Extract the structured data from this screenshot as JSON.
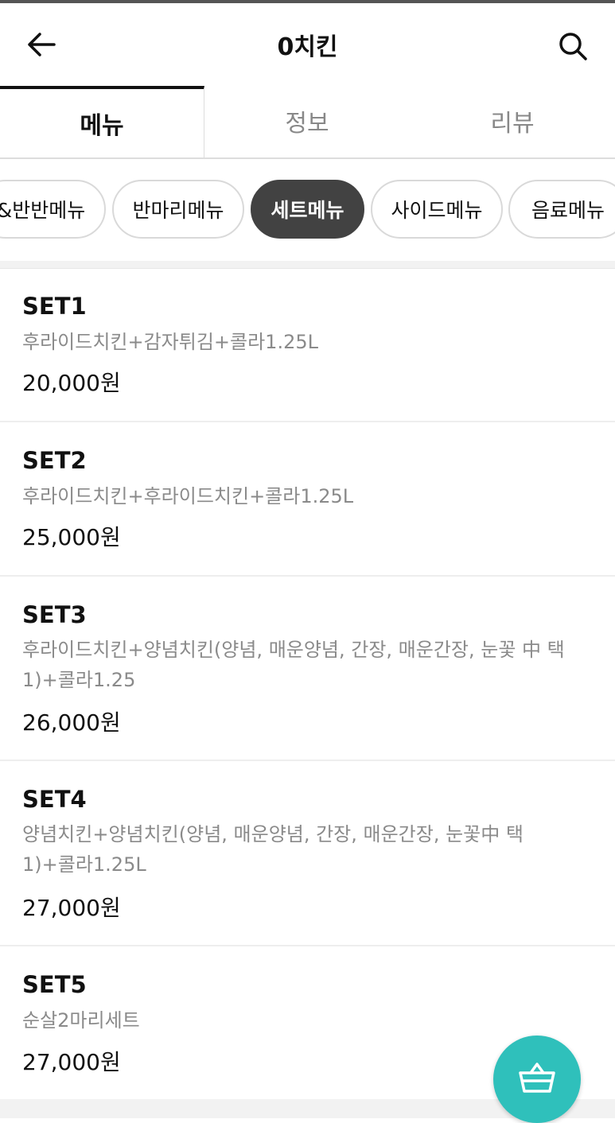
{
  "header": {
    "title": "0치킨",
    "back_icon": "arrow-left-icon",
    "search_icon": "search-icon"
  },
  "tabs": [
    {
      "label": "메뉴",
      "active": true
    },
    {
      "label": "정보",
      "active": false
    },
    {
      "label": "리뷰",
      "active": false
    }
  ],
  "categories": [
    {
      "label": "&반반메뉴",
      "active": false
    },
    {
      "label": "반마리메뉴",
      "active": false
    },
    {
      "label": "세트메뉴",
      "active": true
    },
    {
      "label": "사이드메뉴",
      "active": false
    },
    {
      "label": "음료메뉴",
      "active": false
    }
  ],
  "items": [
    {
      "name": "SET1",
      "desc": "후라이드치킨+감자튀김+콜라1.25L",
      "price": "20,000원"
    },
    {
      "name": "SET2",
      "desc": "후라이드치킨+후라이드치킨+콜라1.25L",
      "price": "25,000원"
    },
    {
      "name": "SET3",
      "desc": "후라이드치킨+양념치킨(양념, 매운양념, 간장, 매운간장, 눈꽃 中 택1)+콜라1.25",
      "price": "26,000원"
    },
    {
      "name": "SET4",
      "desc": "양념치킨+양념치킨(양념, 매운양념, 간장, 매운간장, 눈꽃中 택1)+콜라1.25L",
      "price": "27,000원"
    },
    {
      "name": "SET5",
      "desc": "순살2마리세트",
      "price": "27,000원"
    }
  ],
  "cart": {
    "icon": "basket-icon",
    "color": "#2fc0bb"
  },
  "colors": {
    "active_chip": "#424242",
    "accent": "#2fc0bb"
  }
}
